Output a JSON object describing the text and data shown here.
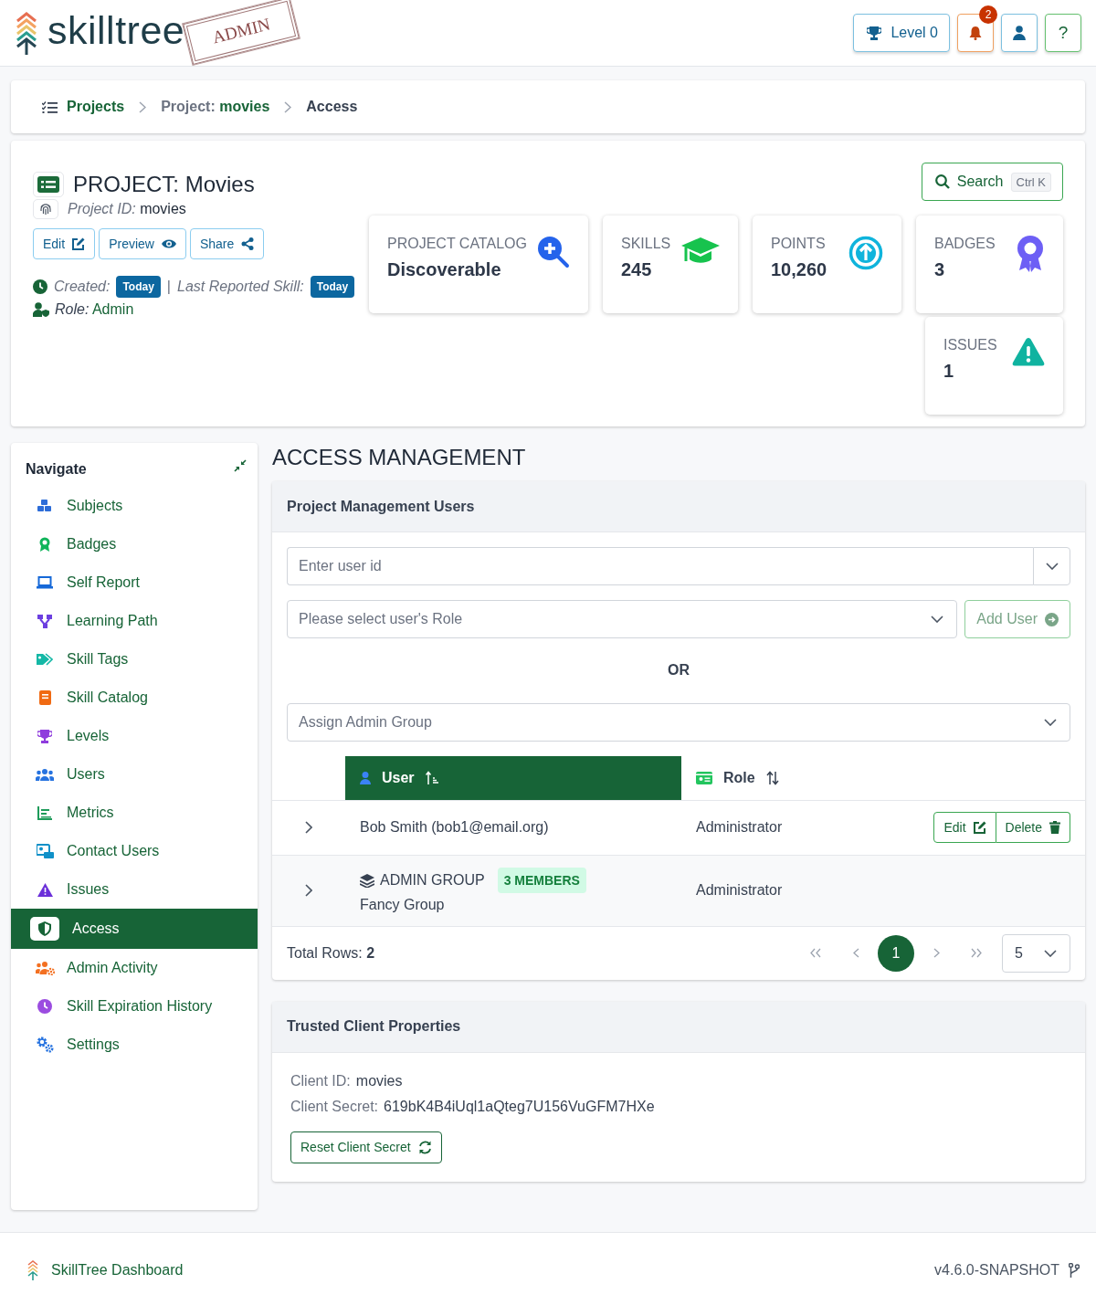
{
  "header": {
    "logo": "skilltree",
    "stamp": "ADMIN",
    "level_button": "Level 0",
    "notification_count": "2",
    "help_button": "?"
  },
  "breadcrumb": [
    {
      "label": "Projects"
    },
    {
      "prefix": "Project:",
      "label": "movies"
    },
    {
      "label": "Access"
    }
  ],
  "project": {
    "title": "PROJECT: Movies",
    "id_label": "Project ID:",
    "id_value": "movies",
    "buttons": [
      {
        "label": "Edit",
        "kind": "edit"
      },
      {
        "label": "Preview",
        "kind": "preview"
      },
      {
        "label": "Share",
        "kind": "share"
      }
    ],
    "created_label": "Created:",
    "created_badge": "Today",
    "separator": "|",
    "last_label": "Last Reported Skill:",
    "last_badge": "Today",
    "role_label": "Role:",
    "role_value": "Admin",
    "search": {
      "label": "Search",
      "shortcut": "Ctrl K"
    },
    "stats": [
      {
        "label": "PROJECT CATALOG",
        "value": "Discoverable",
        "kind": "catalog"
      },
      {
        "label": "SKILLS",
        "value": "245",
        "kind": "skills"
      },
      {
        "label": "POINTS",
        "value": "10,260",
        "kind": "points"
      },
      {
        "label": "BADGES",
        "value": "3",
        "kind": "badges"
      },
      {
        "label": "ISSUES",
        "value": "1",
        "kind": "issues"
      }
    ]
  },
  "nav": {
    "title": "Navigate",
    "items": [
      {
        "label": "Subjects",
        "kind": "cubes",
        "selected": false
      },
      {
        "label": "Badges",
        "kind": "award",
        "selected": false
      },
      {
        "label": "Self Report",
        "kind": "laptop",
        "selected": false
      },
      {
        "label": "Learning Path",
        "kind": "network",
        "selected": false
      },
      {
        "label": "Skill Tags",
        "kind": "tag",
        "selected": false
      },
      {
        "label": "Skill Catalog",
        "kind": "book",
        "selected": false
      },
      {
        "label": "Levels",
        "kind": "trophy",
        "selected": false
      },
      {
        "label": "Users",
        "kind": "users",
        "selected": false
      },
      {
        "label": "Metrics",
        "kind": "chart",
        "selected": false
      },
      {
        "label": "Contact Users",
        "kind": "card",
        "selected": false
      },
      {
        "label": "Issues",
        "kind": "warning",
        "selected": false
      },
      {
        "label": "Access",
        "kind": "shield",
        "selected": true
      },
      {
        "label": "Admin Activity",
        "kind": "usercog",
        "selected": false
      },
      {
        "label": "Skill Expiration History",
        "kind": "clock",
        "selected": false
      },
      {
        "label": "Settings",
        "kind": "gear",
        "selected": false
      }
    ]
  },
  "access": {
    "title": "ACCESS MANAGEMENT",
    "users_card": {
      "title": "Project Management Users",
      "user_id": {
        "placeholder": "Enter user id"
      },
      "role_select": {
        "placeholder": "Please select user's Role"
      },
      "add_button": {
        "label": "Add User",
        "disabled": true
      },
      "or_label": "OR",
      "group_select": {
        "placeholder": "Assign Admin Group"
      },
      "table": {
        "columns": [
          {
            "label": "User",
            "sorted": true
          },
          {
            "label": "Role",
            "sorted": false
          }
        ],
        "rows": [
          {
            "kind": "user",
            "name": "Bob Smith (bob1@email.org)",
            "role": "Administrator",
            "expanded": false,
            "actions": [
              "Edit",
              "Delete"
            ]
          },
          {
            "kind": "group",
            "group_label": "ADMIN GROUP",
            "members_badge": "3 MEMBERS",
            "name": "Fancy Group",
            "role": "Administrator",
            "expanded": false
          }
        ]
      },
      "total_label": "Total Rows:",
      "total_value": "2",
      "pages": [
        {
          "label": "1",
          "selected": true
        }
      ],
      "page_size": "5"
    },
    "client_card": {
      "title": "Trusted Client Properties",
      "properties": [
        {
          "label": "Client ID:",
          "value": "movies"
        },
        {
          "label": "Client Secret:",
          "value": "619bK4B4iUql1aQteg7U156VuGFM7HXe"
        }
      ],
      "reset_button": "Reset Client Secret"
    }
  },
  "footer": {
    "title": "SkillTree Dashboard",
    "version": "v4.6.0-SNAPSHOT"
  }
}
